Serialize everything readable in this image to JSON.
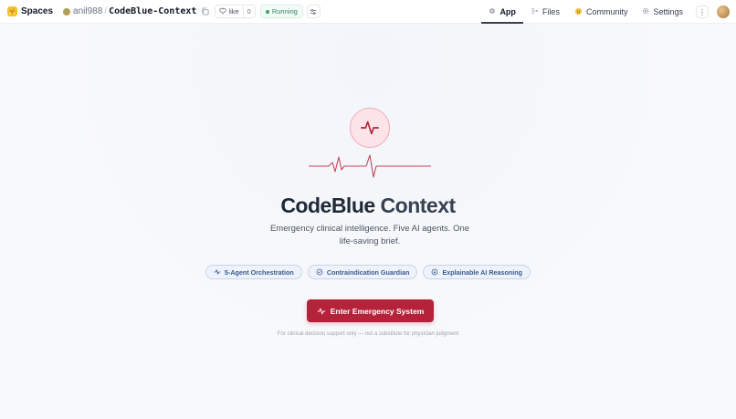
{
  "topbar": {
    "spaces_label": "Spaces",
    "owner": "anil988",
    "separator": "/",
    "repo_name": "CodeBlue-Context",
    "like_label": "like",
    "like_count": "0",
    "status_label": "Running",
    "nav": [
      {
        "label": "App",
        "icon": "app-icon",
        "active": true
      },
      {
        "label": "Files",
        "icon": "files-icon",
        "active": false
      },
      {
        "label": "Community",
        "icon": "community-icon",
        "active": false
      },
      {
        "label": "Settings",
        "icon": "gear-icon",
        "active": false
      }
    ],
    "more_label": "⋮"
  },
  "hero": {
    "title_part1": "CodeBlue",
    "title_part2": "Context",
    "subtitle": "Emergency clinical intelligence. Five AI agents. One life-saving brief.",
    "badges": [
      {
        "label": "5-Agent Orchestration",
        "icon": "activity-icon"
      },
      {
        "label": "Contraindication Guardian",
        "icon": "shield-check-icon"
      },
      {
        "label": "Explainable AI Reasoning",
        "icon": "lightbulb-icon"
      }
    ],
    "cta_label": "Enter Emergency System",
    "disclaimer": "For clinical decision support only — not a substitute for physician judgment"
  },
  "colors": {
    "primary": "#b4233a",
    "pulse_bg": "#fde4e8",
    "badge_text": "#3b5b8c",
    "badge_bg": "#eef3fb",
    "running_green": "#38a169"
  }
}
